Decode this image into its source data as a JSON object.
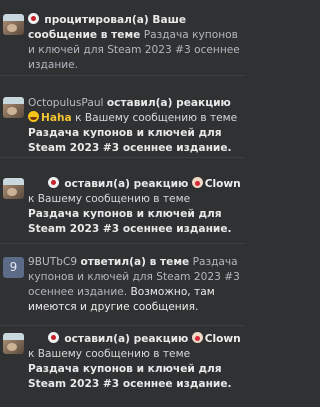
{
  "notifications": [
    {
      "user": "",
      "verb": "процитировал(а) Ваше сообщение в теме",
      "thread": "Раздача купонов и ключей для Steam 2023 #3 осеннее издание."
    },
    {
      "user": "OctopulusPaul",
      "verb": "оставил(а) реакцию",
      "reaction": "Haha",
      "reaction_icon": "haha-emoji-icon",
      "to_text": "к Вашему сообщению в теме",
      "thread": "Раздача купонов и ключей для Steam 2023 #3 осеннее издание."
    },
    {
      "user": "",
      "verb": "оставил(а) реакцию",
      "reaction": "Clown",
      "reaction_icon": "clown-emoji-icon",
      "to_text": "к Вашему сообщению в теме",
      "thread": "Раздача купонов и ключей для Steam 2023 #3 осеннее издание."
    },
    {
      "user": "9BUTbC9",
      "verb": "ответил(а) в теме",
      "thread": "Раздача купонов и ключей для Steam 2023 #3 осеннее издание.",
      "body": "Возможно, там имеются и другие сообщения."
    },
    {
      "user": "",
      "verb": "оставил(а) реакцию",
      "reaction": "Clown",
      "reaction_icon": "clown-emoji-icon",
      "to_text": "к Вашему сообщению в теме",
      "thread": "Раздача купонов и ключей для Steam 2023 #3 осеннее издание."
    }
  ],
  "colors": {
    "background": "#2f3133",
    "divider": "#3b3d40",
    "text": "#d7d7d7",
    "haha": "#f1c232"
  }
}
